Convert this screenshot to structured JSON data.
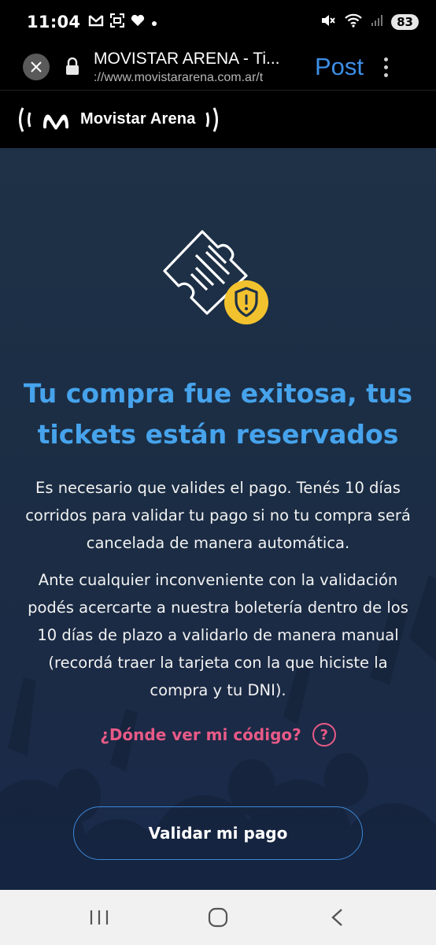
{
  "status_bar": {
    "time": "11:04",
    "left_icons": [
      "gmail-icon",
      "screenshot-icon",
      "heart-icon",
      "dot-icon"
    ],
    "right_icons": [
      "mute-icon",
      "wifi-icon",
      "signal-icon"
    ],
    "battery": "83"
  },
  "browser": {
    "page_title": "MOVISTAR ARENA - Ti...",
    "url": "://www.movistararena.com.ar/t",
    "post_label": "Post"
  },
  "site_header": {
    "brand_name": "Movistar Arena"
  },
  "main": {
    "headline_line1": "Tu compra fue exitosa, tus",
    "headline_line2": "tickets están reservados",
    "paragraph1": "Es necesario que valides el pago. Tenés 10 días corridos para validar tu pago si no tu compra será cancelada de manera automática.",
    "paragraph2": "Ante cualquier inconveniente con la validación podés acercarte a nuestra boletería dentro de los 10 días de plazo a validarlo de manera manual (recordá traer la tarjeta con la que hiciste la compra y tu DNI).",
    "code_link": "¿Dónde ver mi código?",
    "help_symbol": "?",
    "validate_button": "Validar mi pago"
  },
  "colors": {
    "accent_blue": "#46a3ec",
    "link_pink": "#e85a87",
    "shield_yellow": "#f2c22e",
    "browser_post_blue": "#3d8fe8"
  }
}
